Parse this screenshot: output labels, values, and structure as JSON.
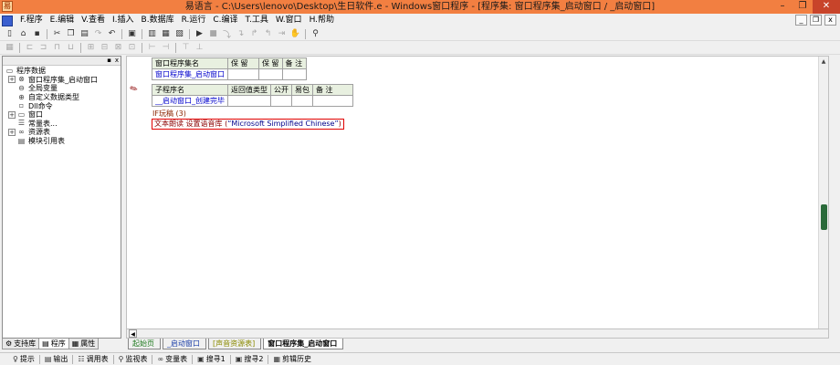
{
  "window": {
    "app_icon": "易",
    "title": "易语言 - C:\\Users\\lenovo\\Desktop\\生日软件.e - Windows窗口程序 - [程序集: 窗口程序集_启动窗口 / _启动窗口]",
    "minimize": "–",
    "restore": "❐",
    "close": "✕"
  },
  "menubar": {
    "items": [
      "F.程序",
      "E.编辑",
      "V.查看",
      "I.插入",
      "B.数据库",
      "R.运行",
      "C.编译",
      "T.工具",
      "W.窗口",
      "H.帮助"
    ],
    "mdi_min": "_",
    "mdi_restore": "❐",
    "mdi_close": "x"
  },
  "left_panel": {
    "pin": "▪",
    "close": "x",
    "tree": [
      {
        "label": "程序数据",
        "level": 0,
        "expander": "",
        "icon": "folder-icon"
      },
      {
        "label": "窗口程序集_启动窗口",
        "level": 1,
        "expander": "+",
        "icon": "module-icon"
      },
      {
        "label": "全局变量",
        "level": 1,
        "expander": "",
        "icon": "variable-icon"
      },
      {
        "label": "自定义数据类型",
        "level": 1,
        "expander": "",
        "icon": "datatype-icon"
      },
      {
        "label": "Dll命令",
        "level": 1,
        "expander": "",
        "icon": "dll-icon"
      },
      {
        "label": "窗口",
        "level": 1,
        "expander": "+",
        "icon": "window-icon"
      },
      {
        "label": "常量表...",
        "level": 1,
        "expander": "",
        "icon": "constant-icon"
      },
      {
        "label": "资源表",
        "level": 1,
        "expander": "+",
        "icon": "resource-icon"
      },
      {
        "label": "模块引用表",
        "level": 1,
        "expander": "",
        "icon": "module-ref-icon"
      }
    ],
    "tabs": [
      {
        "label": "支持库",
        "icon": "support-lib-icon"
      },
      {
        "label": "程序",
        "icon": "program-icon"
      },
      {
        "label": "属性",
        "icon": "property-icon"
      }
    ]
  },
  "editor": {
    "assembly_table": {
      "headers": [
        "窗口程序集名",
        "保 留",
        "保 留",
        "备 注"
      ],
      "row": [
        "窗口程序集_启动窗口",
        "",
        "",
        ""
      ]
    },
    "sub_table": {
      "headers": [
        "子程序名",
        "返回值类型",
        "公开",
        "易包",
        "备 注"
      ],
      "row": [
        "__启动窗口_创建完毕",
        "",
        "",
        "",
        ""
      ]
    },
    "code_lines": [
      "IF玩稿 (3)",
      "文本朗读 设置语音库 (“Microsoft Simplified Chinese”)"
    ],
    "code_line2": {
      "prefix": "文本朗读 设置语音库 (",
      "string": "“Microsoft Simplified Chinese”",
      "suffix": ")"
    }
  },
  "doc_tabs": [
    "起始页",
    "_启动窗口",
    "[声音资源表]",
    "窗口程序集_启动窗口"
  ],
  "bottom_bar": [
    {
      "label": "提示",
      "icon": "hint-icon"
    },
    {
      "label": "输出",
      "icon": "output-icon"
    },
    {
      "label": "调用表",
      "icon": "calltable-icon"
    },
    {
      "label": "监视表",
      "icon": "watch-icon"
    },
    {
      "label": "变量表",
      "icon": "variables-icon"
    },
    {
      "label": "搜寻1",
      "icon": "search1-icon"
    },
    {
      "label": "搜寻2",
      "icon": "search2-icon"
    },
    {
      "label": "剪辑历史",
      "icon": "clipboard-history-icon"
    }
  ],
  "colors": {
    "titlebar": "#f27f41",
    "close_button": "#c8442a",
    "scroll_thumb": "#2a6a3a",
    "error_border": "#e00000"
  }
}
